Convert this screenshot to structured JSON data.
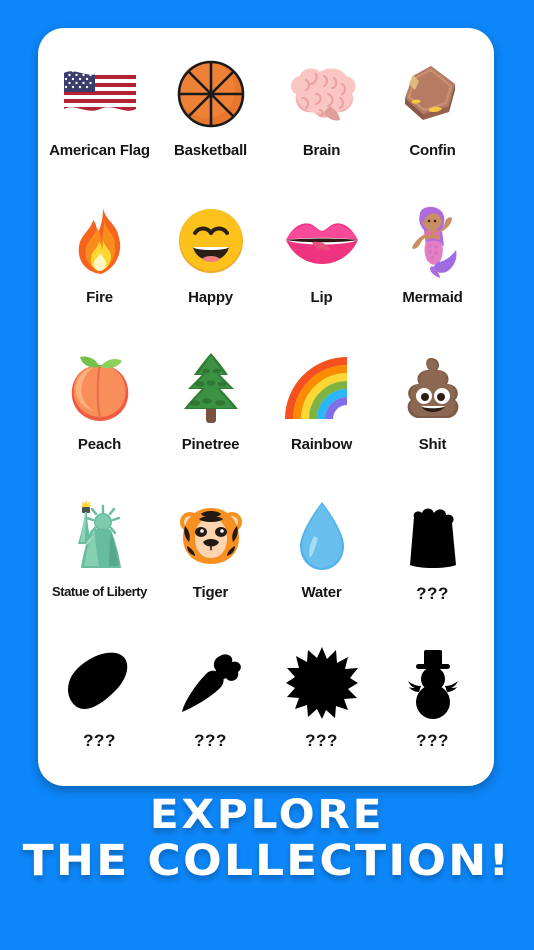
{
  "theme": {
    "background_color": "#0d86f8",
    "card_color": "#ffffff",
    "label_color": "#151515",
    "locked_silhouette_color": "#000000",
    "headline_color": "#ffffff"
  },
  "card": {
    "name": "emoji-collection-card"
  },
  "grid": {
    "columns": 4,
    "rows": 5,
    "items": [
      {
        "label": "American Flag",
        "icon": "american-flag-emoji",
        "locked": false
      },
      {
        "label": "Basketball",
        "icon": "basketball-emoji",
        "locked": false
      },
      {
        "label": "Brain",
        "icon": "brain-emoji",
        "locked": false
      },
      {
        "label": "Confin",
        "icon": "coffin-emoji",
        "locked": false
      },
      {
        "label": "Fire",
        "icon": "fire-emoji",
        "locked": false
      },
      {
        "label": "Happy",
        "icon": "happy-face-emoji",
        "locked": false
      },
      {
        "label": "Lip",
        "icon": "lips-emoji",
        "locked": false
      },
      {
        "label": "Mermaid",
        "icon": "mermaid-emoji",
        "locked": false
      },
      {
        "label": "Peach",
        "icon": "peach-emoji",
        "locked": false
      },
      {
        "label": "Pinetree",
        "icon": "pine-tree-emoji",
        "locked": false
      },
      {
        "label": "Rainbow",
        "icon": "rainbow-emoji",
        "locked": false
      },
      {
        "label": "Shit",
        "icon": "pile-of-poo-emoji",
        "locked": false
      },
      {
        "label": "Statue of Liberty",
        "icon": "statue-of-liberty-emoji",
        "locked": false
      },
      {
        "label": "Tiger",
        "icon": "tiger-face-emoji",
        "locked": false
      },
      {
        "label": "Water",
        "icon": "water-drop-emoji",
        "locked": false
      },
      {
        "label": "???",
        "icon": "locked-popcorn-silhouette",
        "locked": true
      },
      {
        "label": "???",
        "icon": "locked-avocado-silhouette",
        "locked": true
      },
      {
        "label": "???",
        "icon": "locked-carrot-silhouette",
        "locked": true
      },
      {
        "label": "???",
        "icon": "locked-star-silhouette",
        "locked": true
      },
      {
        "label": "???",
        "icon": "locked-snowman-silhouette",
        "locked": true
      }
    ]
  },
  "headline": {
    "line1": "Explore",
    "line2": "The Collection!"
  }
}
